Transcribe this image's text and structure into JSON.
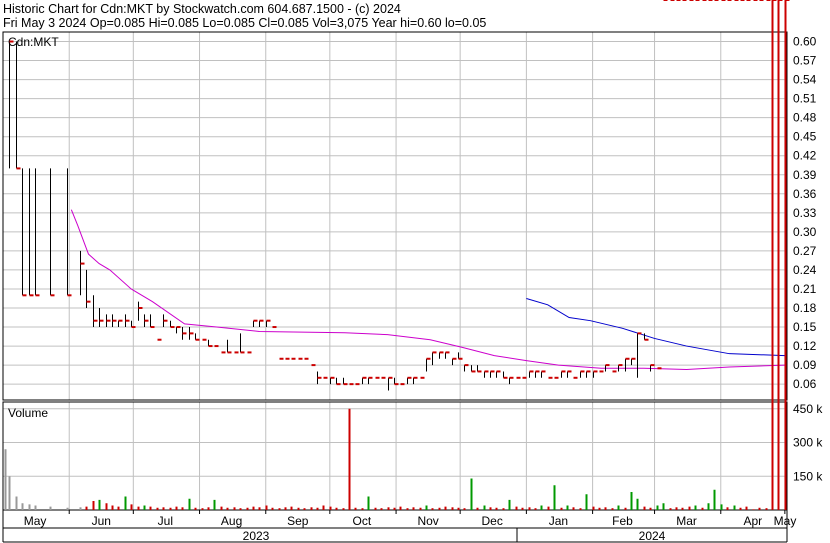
{
  "header": {
    "line1": "Historic Chart for Cdn:MKT by Stockwatch.com 604.687.1500 - (c) 2024",
    "line2": "Fri May  3 2024   Op=0.085   Hi=0.085   Lo=0.085   Cl=0.085   Vol=3,075   Year hi=0.60   lo=0.05"
  },
  "colors": {
    "price": "#000000",
    "close_tick": "#cc0000",
    "ma_short": "#cc00cc",
    "ma_long": "#0000cc",
    "vol_up": "#009900",
    "vol_down": "#cc0000",
    "vol_neutral": "#999999",
    "grid": "#c0c0c0"
  },
  "chart_data": [
    {
      "type": "ohlc",
      "title": "Cdn:MKT",
      "ylim": [
        0.035,
        0.615
      ],
      "y_ticks": [
        "0.60",
        "0.57",
        "0.54",
        "0.51",
        "0.48",
        "0.45",
        "0.42",
        "0.39",
        "0.36",
        "0.33",
        "0.30",
        "0.27",
        "0.24",
        "0.21",
        "0.18",
        "0.15",
        "0.12",
        "0.09",
        "0.06"
      ],
      "grid": true,
      "series": [
        {
          "kind": "ohlc_bars",
          "d": [
            3,
            6,
            9,
            12,
            15,
            22,
            30,
            36,
            39,
            42,
            45,
            48,
            51,
            54,
            57,
            60,
            63,
            66,
            69,
            72,
            75,
            78,
            81,
            84,
            87,
            90,
            93,
            96,
            99,
            102,
            105,
            108,
            111,
            114,
            117,
            120,
            123,
            126,
            129,
            132,
            135,
            138,
            141,
            144,
            147,
            150,
            153,
            156,
            159,
            162,
            165,
            168,
            171,
            174,
            177,
            180,
            183,
            186,
            189,
            192,
            195,
            198,
            201,
            204,
            207,
            210,
            213,
            216,
            219,
            222,
            225,
            228,
            231,
            234,
            237,
            240,
            243,
            246,
            249,
            252,
            255,
            258,
            261,
            264,
            267,
            270,
            273,
            276,
            279,
            282,
            285,
            288,
            291,
            294,
            297,
            300,
            303,
            306,
            309,
            312,
            315,
            318,
            321,
            324,
            327,
            330,
            333,
            336,
            339,
            342,
            345,
            348,
            351,
            354,
            357,
            360,
            363,
            366
          ],
          "high": [
            0.6,
            0.6,
            0.4,
            0.4,
            0.4,
            0.4,
            0.4,
            0.27,
            0.24,
            0.2,
            0.18,
            0.17,
            0.17,
            0.16,
            0.17,
            0.16,
            0.19,
            0.17,
            0.17,
            0.13,
            0.17,
            0.16,
            0.15,
            0.15,
            0.15,
            0.14,
            0.13,
            0.13,
            0.12,
            0.11,
            0.13,
            0.11,
            0.14,
            0.11,
            0.16,
            0.16,
            0.16,
            0.15,
            0.1,
            0.1,
            0.1,
            0.1,
            0.1,
            0.09,
            0.08,
            0.07,
            0.07,
            0.07,
            0.07,
            0.06,
            0.06,
            0.07,
            0.07,
            0.07,
            0.07,
            0.07,
            0.07,
            0.06,
            0.07,
            0.07,
            0.07,
            0.1,
            0.11,
            0.11,
            0.11,
            0.1,
            0.11,
            0.09,
            0.09,
            0.09,
            0.08,
            0.08,
            0.08,
            0.08,
            0.07,
            0.07,
            0.07,
            0.08,
            0.08,
            0.08,
            0.07,
            0.07,
            0.08,
            0.08,
            0.07,
            0.08,
            0.08,
            0.08,
            0.08,
            0.09,
            0.08,
            0.09,
            0.1,
            0.1,
            0.14,
            0.14,
            0.09,
            0.085
          ],
          "low": [
            0.4,
            0.4,
            0.2,
            0.2,
            0.2,
            0.2,
            0.2,
            0.2,
            0.18,
            0.15,
            0.15,
            0.15,
            0.15,
            0.15,
            0.15,
            0.15,
            0.16,
            0.15,
            0.15,
            0.13,
            0.15,
            0.15,
            0.14,
            0.13,
            0.13,
            0.13,
            0.13,
            0.12,
            0.12,
            0.11,
            0.11,
            0.11,
            0.11,
            0.11,
            0.15,
            0.15,
            0.15,
            0.15,
            0.1,
            0.1,
            0.1,
            0.1,
            0.1,
            0.09,
            0.06,
            0.07,
            0.06,
            0.06,
            0.06,
            0.06,
            0.06,
            0.06,
            0.06,
            0.07,
            0.07,
            0.05,
            0.06,
            0.06,
            0.06,
            0.06,
            0.07,
            0.08,
            0.09,
            0.1,
            0.1,
            0.09,
            0.1,
            0.08,
            0.08,
            0.08,
            0.07,
            0.07,
            0.07,
            0.07,
            0.06,
            0.07,
            0.07,
            0.07,
            0.07,
            0.07,
            0.07,
            0.07,
            0.07,
            0.07,
            0.07,
            0.07,
            0.07,
            0.07,
            0.08,
            0.08,
            0.08,
            0.08,
            0.08,
            0.09,
            0.07,
            0.13,
            0.08,
            0.085
          ],
          "close": [
            0.6,
            0.4,
            0.2,
            0.2,
            0.2,
            0.2,
            0.2,
            0.25,
            0.19,
            0.16,
            0.16,
            0.16,
            0.16,
            0.16,
            0.16,
            0.15,
            0.18,
            0.16,
            0.15,
            0.13,
            0.16,
            0.15,
            0.15,
            0.14,
            0.14,
            0.13,
            0.13,
            0.12,
            0.12,
            0.11,
            0.11,
            0.11,
            0.11,
            0.11,
            0.16,
            0.16,
            0.16,
            0.15,
            0.1,
            0.1,
            0.1,
            0.1,
            0.1,
            0.09,
            0.07,
            0.07,
            0.07,
            0.06,
            0.06,
            0.06,
            0.06,
            0.07,
            0.07,
            0.07,
            0.07,
            0.07,
            0.06,
            0.06,
            0.07,
            0.07,
            0.07,
            0.1,
            0.11,
            0.11,
            0.11,
            0.1,
            0.1,
            0.09,
            0.08,
            0.08,
            0.08,
            0.08,
            0.08,
            0.07,
            0.07,
            0.07,
            0.07,
            0.08,
            0.08,
            0.08,
            0.07,
            0.07,
            0.08,
            0.08,
            0.07,
            0.08,
            0.08,
            0.08,
            0.08,
            0.09,
            0.08,
            0.09,
            0.1,
            0.1,
            0.14,
            0.13,
            0.09,
            0.085
          ]
        },
        {
          "kind": "ma_short",
          "d": [
            32,
            35,
            40,
            45,
            50,
            60,
            70,
            85,
            100,
            120,
            140,
            160,
            180,
            200,
            215,
            230,
            245,
            260,
            280,
            300,
            320,
            340,
            366
          ],
          "values": [
            0.335,
            0.31,
            0.265,
            0.25,
            0.24,
            0.21,
            0.19,
            0.155,
            0.15,
            0.143,
            0.142,
            0.141,
            0.138,
            0.13,
            0.118,
            0.105,
            0.097,
            0.09,
            0.085,
            0.085,
            0.083,
            0.087,
            0.09
          ]
        },
        {
          "kind": "ma_long",
          "d": [
            245,
            255,
            265,
            275,
            290,
            305,
            320,
            340,
            366
          ],
          "values": [
            0.195,
            0.185,
            0.165,
            0.16,
            0.148,
            0.132,
            0.12,
            0.108,
            0.105
          ]
        }
      ]
    },
    {
      "type": "bar",
      "title": "Volume",
      "ylim": [
        0,
        480000
      ],
      "y_ticks": [
        "450 k",
        "300 k",
        "150 k"
      ],
      "x_month_labels": [
        "May",
        "Jun",
        "Jul",
        "Aug",
        "Sep",
        "Oct",
        "Nov",
        "Dec",
        "Jan",
        "Feb",
        "Mar",
        "Apr",
        "May"
      ],
      "year_labels": [
        "2023",
        "2024"
      ],
      "d": [
        1,
        3,
        6,
        9,
        12,
        15,
        22,
        30,
        36,
        39,
        42,
        45,
        48,
        51,
        54,
        57,
        60,
        63,
        66,
        69,
        72,
        75,
        78,
        81,
        84,
        87,
        90,
        93,
        96,
        99,
        102,
        105,
        108,
        111,
        114,
        117,
        120,
        123,
        126,
        129,
        132,
        135,
        138,
        141,
        144,
        147,
        150,
        153,
        156,
        159,
        162,
        165,
        168,
        171,
        174,
        177,
        180,
        183,
        186,
        189,
        192,
        195,
        198,
        201,
        204,
        207,
        210,
        213,
        216,
        219,
        222,
        225,
        228,
        231,
        234,
        237,
        240,
        243,
        246,
        249,
        252,
        255,
        258,
        261,
        264,
        267,
        270,
        273,
        276,
        279,
        282,
        285,
        288,
        291,
        294,
        297,
        300,
        303,
        306,
        309,
        312,
        315,
        318,
        321,
        324,
        327,
        330,
        333,
        336,
        339,
        342,
        345,
        348,
        351,
        354,
        357,
        360,
        363,
        366
      ],
      "values": [
        270000,
        150000,
        60000,
        30000,
        25000,
        20000,
        15000,
        10000,
        12000,
        15000,
        40000,
        45000,
        30000,
        20000,
        15000,
        60000,
        25000,
        15000,
        20000,
        15000,
        10000,
        12000,
        10000,
        15000,
        12000,
        50000,
        10000,
        8000,
        12000,
        45000,
        15000,
        10000,
        12000,
        8000,
        10000,
        15000,
        12000,
        20000,
        10000,
        8000,
        12000,
        15000,
        10000,
        8000,
        12000,
        10000,
        20000,
        15000,
        10000,
        8000,
        450000,
        10000,
        8000,
        60000,
        10000,
        8000,
        12000,
        10000,
        15000,
        8000,
        12000,
        10000,
        20000,
        8000,
        10000,
        15000,
        12000,
        10000,
        8000,
        140000,
        10000,
        20000,
        12000,
        10000,
        8000,
        45000,
        15000,
        10000,
        12000,
        8000,
        20000,
        15000,
        110000,
        10000,
        20000,
        12000,
        8000,
        70000,
        15000,
        10000,
        12000,
        8000,
        20000,
        10000,
        80000,
        50000,
        15000,
        10000,
        20000,
        30000,
        8000,
        12000,
        10000,
        15000,
        20000,
        10000,
        30000,
        90000,
        25000,
        12000,
        20000,
        10000,
        15000,
        3075,
        10000,
        8000
      ],
      "direction": [
        "n",
        "n",
        "n",
        "n",
        "n",
        "n",
        "n",
        "n",
        "n",
        "d",
        "d",
        "u",
        "d",
        "d",
        "d",
        "u",
        "d",
        "d",
        "u",
        "d",
        "d",
        "d",
        "d",
        "d",
        "d",
        "u",
        "d",
        "d",
        "d",
        "u",
        "d",
        "d",
        "d",
        "d",
        "d",
        "d",
        "d",
        "d",
        "d",
        "d",
        "d",
        "d",
        "d",
        "d",
        "d",
        "d",
        "d",
        "d",
        "d",
        "d",
        "d",
        "d",
        "d",
        "u",
        "d",
        "d",
        "d",
        "d",
        "d",
        "d",
        "d",
        "d",
        "u",
        "d",
        "d",
        "d",
        "d",
        "d",
        "d",
        "u",
        "d",
        "u",
        "d",
        "d",
        "d",
        "u",
        "d",
        "d",
        "d",
        "d",
        "u",
        "d",
        "u",
        "d",
        "u",
        "d",
        "d",
        "u",
        "d",
        "d",
        "d",
        "d",
        "u",
        "d",
        "u",
        "u",
        "d",
        "d",
        "u",
        "u",
        "d",
        "d",
        "d",
        "d",
        "u",
        "d",
        "u",
        "u",
        "u",
        "d",
        "u",
        "d",
        "d",
        "d",
        "d",
        "d",
        "d",
        "d",
        "d",
        "d"
      ]
    }
  ]
}
